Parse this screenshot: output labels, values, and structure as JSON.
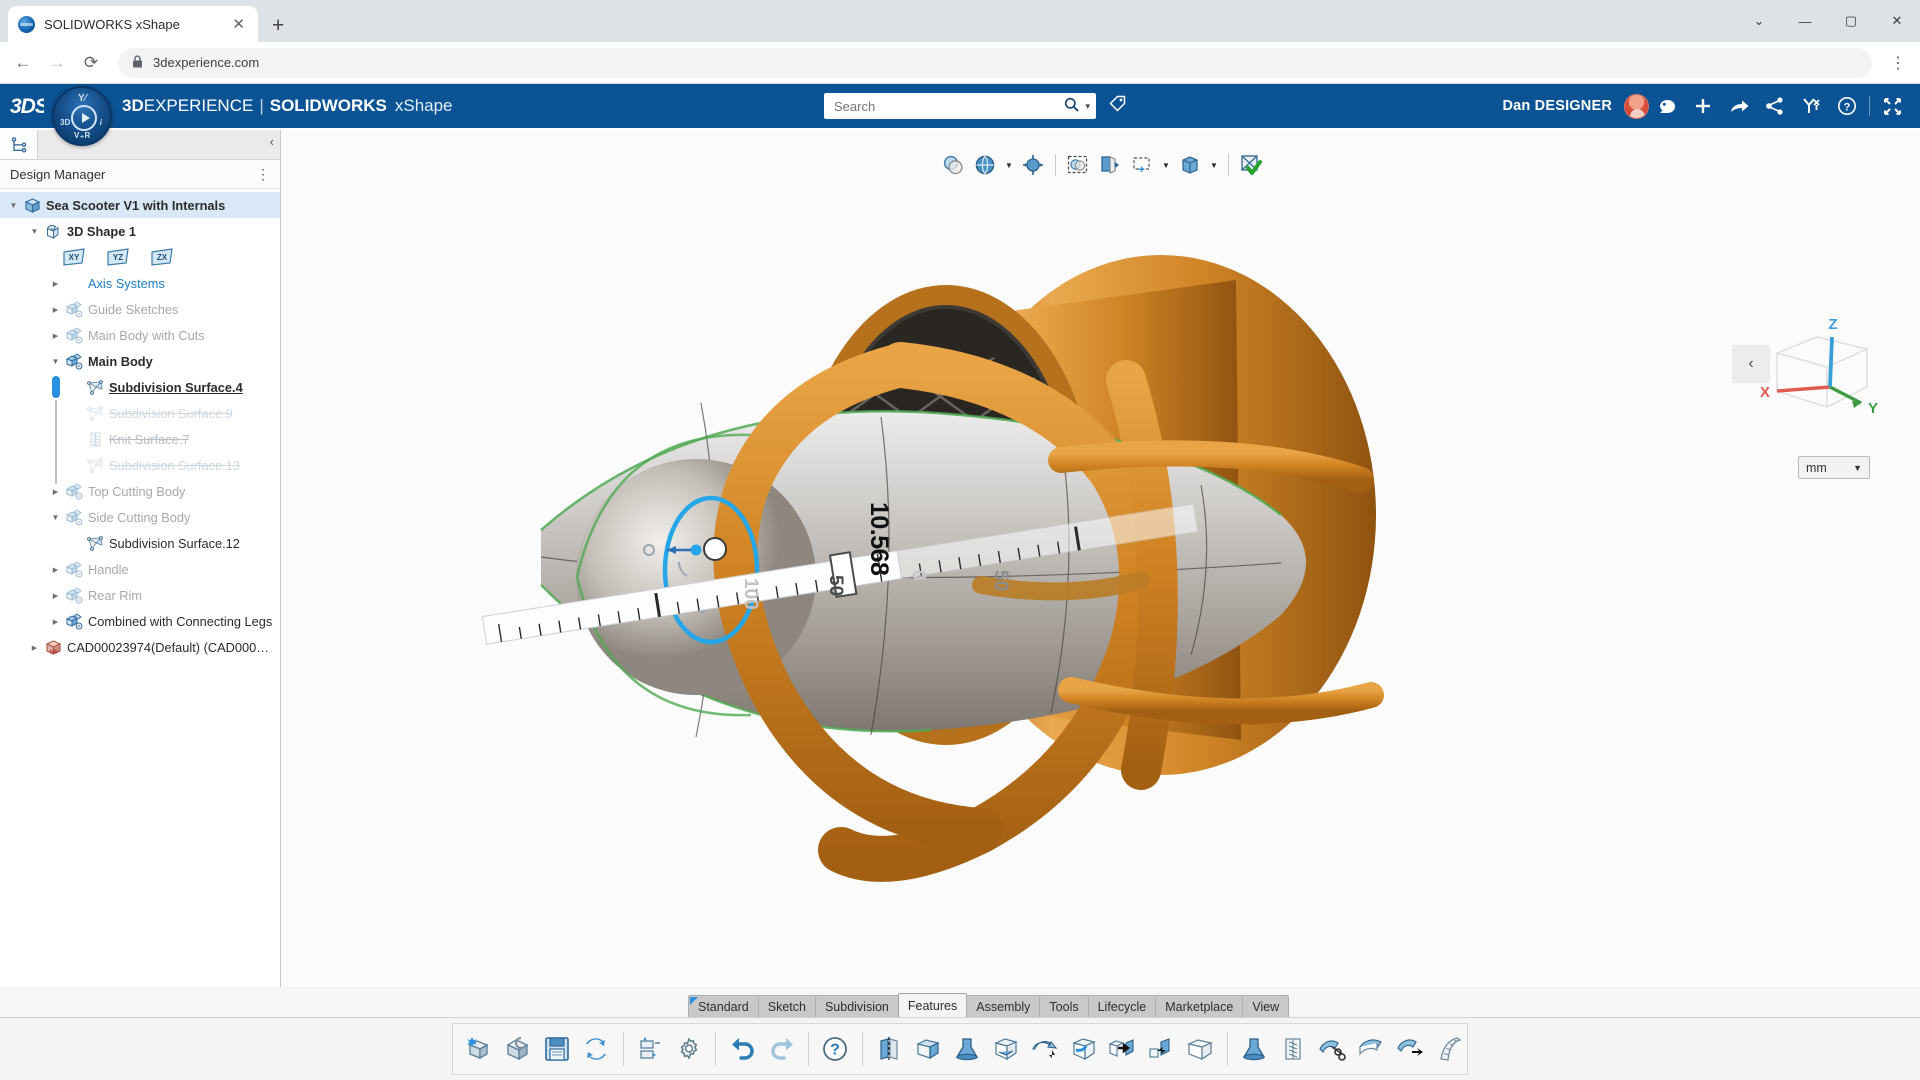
{
  "browser": {
    "tab_title": "SOLIDWORKS xShape",
    "tab_close": "✕",
    "new_tab": "+",
    "back": "←",
    "forward": "→",
    "reload": "⟳",
    "lock_glyph": "🔒",
    "url": "3dexperience.com",
    "menu": "⋮",
    "win_minimize": "—",
    "win_maximize": "▢",
    "win_close": "✕",
    "win_chevron": "⌄"
  },
  "topbar": {
    "logo_text": "3DS",
    "compass": {
      "seg_3d": "3D",
      "seg_i": "i",
      "seg_vr": "V₊R",
      "seg_y": "Y⁄"
    },
    "title_bold1": "3D",
    "title_light1": "EXPERIENCE",
    "pipe": "|",
    "title_bold2": "SOLIDWORKS",
    "title_sub": "xShape",
    "search_placeholder": "Search",
    "search_value": "",
    "search_icon": "search-icon",
    "search_caret": "▾",
    "tag_icon": "tag-icon",
    "user_name": "Dan DESIGNER",
    "icons": [
      "avatar",
      "bookmark-icon",
      "plus-icon",
      "share-arrow-icon",
      "share-node-icon",
      "collaborate-icon",
      "help-icon",
      "expand-icon"
    ]
  },
  "sidebar": {
    "collapse_glyph": "‹",
    "tab_icon": "tree-icon",
    "header_title": "Design Manager",
    "header_menu": "⋮",
    "tree": [
      {
        "label": "Sea Scooter V1 with Internals",
        "depth": 0,
        "twisty": "down",
        "icon": "product-cube-icon",
        "style": "bold sel"
      },
      {
        "label": "3D Shape 1",
        "depth": 1,
        "twisty": "down",
        "icon": "shape-icon",
        "style": "bold"
      },
      {
        "label": "",
        "depth": 2,
        "twisty": "blank",
        "icon": "planes-row",
        "style": "planes"
      },
      {
        "label": "Axis Systems",
        "depth": 2,
        "twisty": "right",
        "icon": "none",
        "style": "link"
      },
      {
        "label": "Guide Sketches",
        "depth": 2,
        "twisty": "right",
        "icon": "subd-body-icon",
        "style": "muted"
      },
      {
        "label": "Main Body with Cuts",
        "depth": 2,
        "twisty": "right",
        "icon": "subd-body-icon",
        "style": "muted"
      },
      {
        "label": "Main Body",
        "depth": 2,
        "twisty": "down",
        "icon": "subd-body-icon",
        "style": "bold"
      },
      {
        "label": "Subdivision Surface.4",
        "depth": 3,
        "twisty": "blank",
        "icon": "subd-surface-icon",
        "style": "underline"
      },
      {
        "label": "Subdivision Surface.9",
        "depth": 3,
        "twisty": "blank",
        "icon": "subd-surface-icon",
        "style": "ghost"
      },
      {
        "label": "Knit Surface.7",
        "depth": 3,
        "twisty": "blank",
        "icon": "knit-surface-icon",
        "style": "struck"
      },
      {
        "label": "Subdivision Surface.13",
        "depth": 3,
        "twisty": "blank",
        "icon": "subd-surface-icon",
        "style": "ghost"
      },
      {
        "label": "Top Cutting Body",
        "depth": 2,
        "twisty": "right",
        "icon": "subd-body-icon",
        "style": "muted"
      },
      {
        "label": "Side Cutting Body",
        "depth": 2,
        "twisty": "down",
        "icon": "subd-body-icon",
        "style": "muted"
      },
      {
        "label": "Subdivision Surface.12",
        "depth": 3,
        "twisty": "blank",
        "icon": "subd-surface-icon",
        "style": "normal"
      },
      {
        "label": "Handle",
        "depth": 2,
        "twisty": "right",
        "icon": "subd-body-icon",
        "style": "muted"
      },
      {
        "label": "Rear Rim",
        "depth": 2,
        "twisty": "right",
        "icon": "subd-body-icon",
        "style": "muted"
      },
      {
        "label": "Combined with Connecting Legs",
        "depth": 2,
        "twisty": "right",
        "icon": "subd-body-icon",
        "style": "normal"
      },
      {
        "label": "CAD00023974(Default) (CAD0002…",
        "depth": 1,
        "twisty": "right",
        "icon": "cad-part-icon",
        "style": "normal"
      }
    ],
    "plane_labels": [
      "XY",
      "YZ",
      "ZX"
    ]
  },
  "viewport": {
    "toolbar_icons": [
      "transparency-icon",
      "display-style-icon",
      "caret-down",
      "show-hide-icon",
      "separator",
      "select-visible-icon",
      "section-view-icon",
      "box-select-icon",
      "caret-down",
      "hide-show-body-icon",
      "caret-down",
      "separator",
      "exit-app-icon",
      "confirm-check"
    ],
    "panel_arrow": "‹",
    "triad": {
      "x_label": "X",
      "y_label": "Y",
      "z_label": "Z",
      "x_color": "#e05b4f",
      "y_color": "#3f9b43",
      "z_color": "#3a9fd8"
    },
    "units_value": "mm",
    "units_caret": "▼",
    "dimension_value": "10.568",
    "ruler_ticks": [
      "100",
      "50",
      "0",
      "50"
    ],
    "model_color": "#d8892a",
    "highlight_color": "#24a6e8"
  },
  "command_tabs": [
    {
      "label": "Standard",
      "active": false,
      "first": true
    },
    {
      "label": "Sketch",
      "active": false
    },
    {
      "label": "Subdivision",
      "active": false
    },
    {
      "label": "Features",
      "active": true
    },
    {
      "label": "Assembly",
      "active": false
    },
    {
      "label": "Tools",
      "active": false
    },
    {
      "label": "Lifecycle",
      "active": false
    },
    {
      "label": "Marketplace",
      "active": false
    },
    {
      "label": "View",
      "active": false
    }
  ],
  "command_bar": {
    "overflow_caret": "⌄",
    "icons": [
      "new-part-icon",
      "open-part-icon",
      "save-icon",
      "refresh-icon",
      "separator",
      "arrange-icon",
      "settings-gear-icon",
      "separator",
      "undo-icon",
      "redo-icon",
      "separator",
      "help-icon",
      "separator",
      "mirror-icon",
      "extrude-cut-icon",
      "revolve-boss-icon",
      "shell-icon",
      "draft-icon",
      "fillet-icon",
      "boolean-icon",
      "combine-icon",
      "pattern-icon",
      "separator",
      "revolve-icon",
      "knit-surface-icon",
      "trim-surface-icon",
      "thicken-icon",
      "move-face-icon",
      "ruled-surface-icon"
    ]
  }
}
